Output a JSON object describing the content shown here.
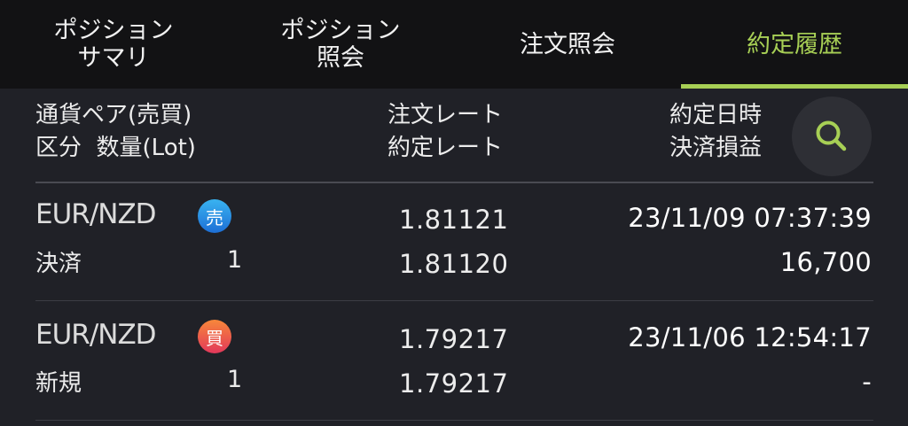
{
  "tabs": [
    {
      "label": "ポジション\nサマリ"
    },
    {
      "label": "ポジション\n照会"
    },
    {
      "label": "注文照会"
    },
    {
      "label": "約定履歴"
    }
  ],
  "active_tab_index": 3,
  "columns": {
    "pair_side": "通貨ペア(売買)",
    "kind_qty": "区分  数量(Lot)",
    "order_rate": "注文レート",
    "exec_rate": "約定レート",
    "exec_datetime": "約定日時",
    "settlement_pl": "決済損益"
  },
  "rows": [
    {
      "pair": "EUR/NZD",
      "side": "売",
      "side_color": "#1d6fd6",
      "kind": "決済",
      "qty": "1",
      "order_rate": "1.81121",
      "exec_rate": "1.81120",
      "datetime": "23/11/09 07:37:39",
      "pl": "16,700"
    },
    {
      "pair": "EUR/NZD",
      "side": "買",
      "side_color": "#e2385a",
      "kind": "新規",
      "qty": "1",
      "order_rate": "1.79217",
      "exec_rate": "1.79217",
      "datetime": "23/11/06 12:54:17",
      "pl": "-"
    }
  ],
  "icons": {
    "search": "search-icon"
  },
  "colors": {
    "accent": "#a7cf55",
    "background": "#202127",
    "tabbar": "#121214"
  }
}
